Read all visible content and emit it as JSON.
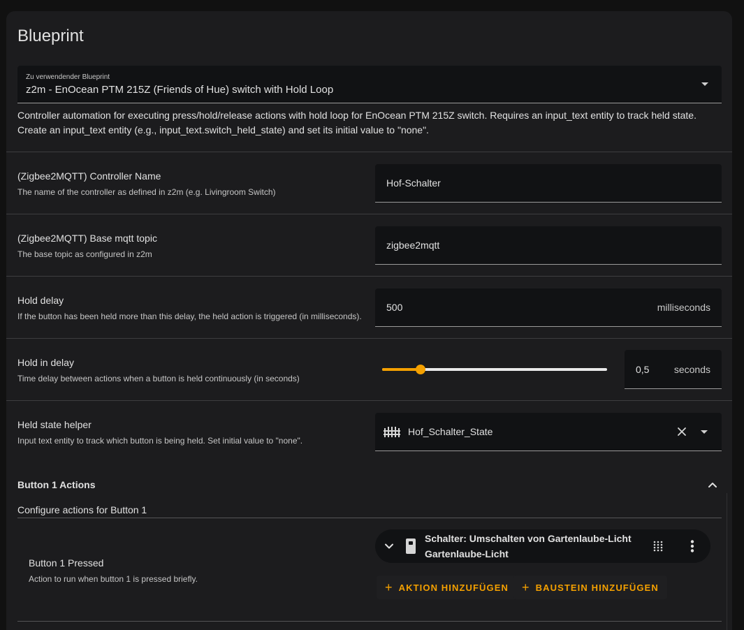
{
  "card": {
    "title": "Blueprint"
  },
  "blueprint_select": {
    "label": "Zu verwendender Blueprint",
    "value": "z2m - EnOcean PTM 215Z (Friends of Hue) switch with Hold Loop"
  },
  "description": {
    "line1": "Controller automation for executing press/hold/release actions with hold loop for EnOcean PTM 215Z switch. Requires an input_text entity to track held state.",
    "line2": "Create an input_text entity (e.g., input_text.switch_held_state) and set its initial value to \"none\"."
  },
  "controller_name": {
    "title": "(Zigbee2MQTT) Controller Name",
    "description": "The name of the controller as defined in z2m (e.g. Livingroom Switch)",
    "value": "Hof-Schalter"
  },
  "base_topic": {
    "title": "(Zigbee2MQTT) Base mqtt topic",
    "description": "The base topic as configured in z2m",
    "value": "zigbee2mqtt"
  },
  "hold_delay": {
    "title": "Hold delay",
    "description": "If the button has been held more than this delay, the held action is triggered (in milliseconds).",
    "value": "500",
    "unit": "milliseconds"
  },
  "hold_in_delay": {
    "title": "Hold in delay",
    "description": "Time delay between actions when a button is held continuously (in seconds)",
    "value": "0,5",
    "unit": "seconds",
    "slider_fraction": 0.17
  },
  "held_state": {
    "title": "Held state helper",
    "description": "Input text entity to track which button is being held. Set initial value to \"none\".",
    "value": "Hof_Schalter_State"
  },
  "button1": {
    "section_title": "Button 1 Actions",
    "section_subtitle": "Configure actions for Button 1",
    "pressed_title": "Button 1 Pressed",
    "pressed_description": "Action to run when button 1 is pressed briefly.",
    "action_title": "Schalter: Umschalten von Gartenlaube-Licht",
    "action_subtitle": "Gartenlaube-Licht",
    "add_action_label": "AKTION HINZUFÜGEN",
    "add_block_label": "BAUSTEIN HINZUFÜGEN"
  },
  "colors": {
    "accent": "#f4a000",
    "card_bg": "#1c1c1e",
    "field_bg": "#111214"
  }
}
